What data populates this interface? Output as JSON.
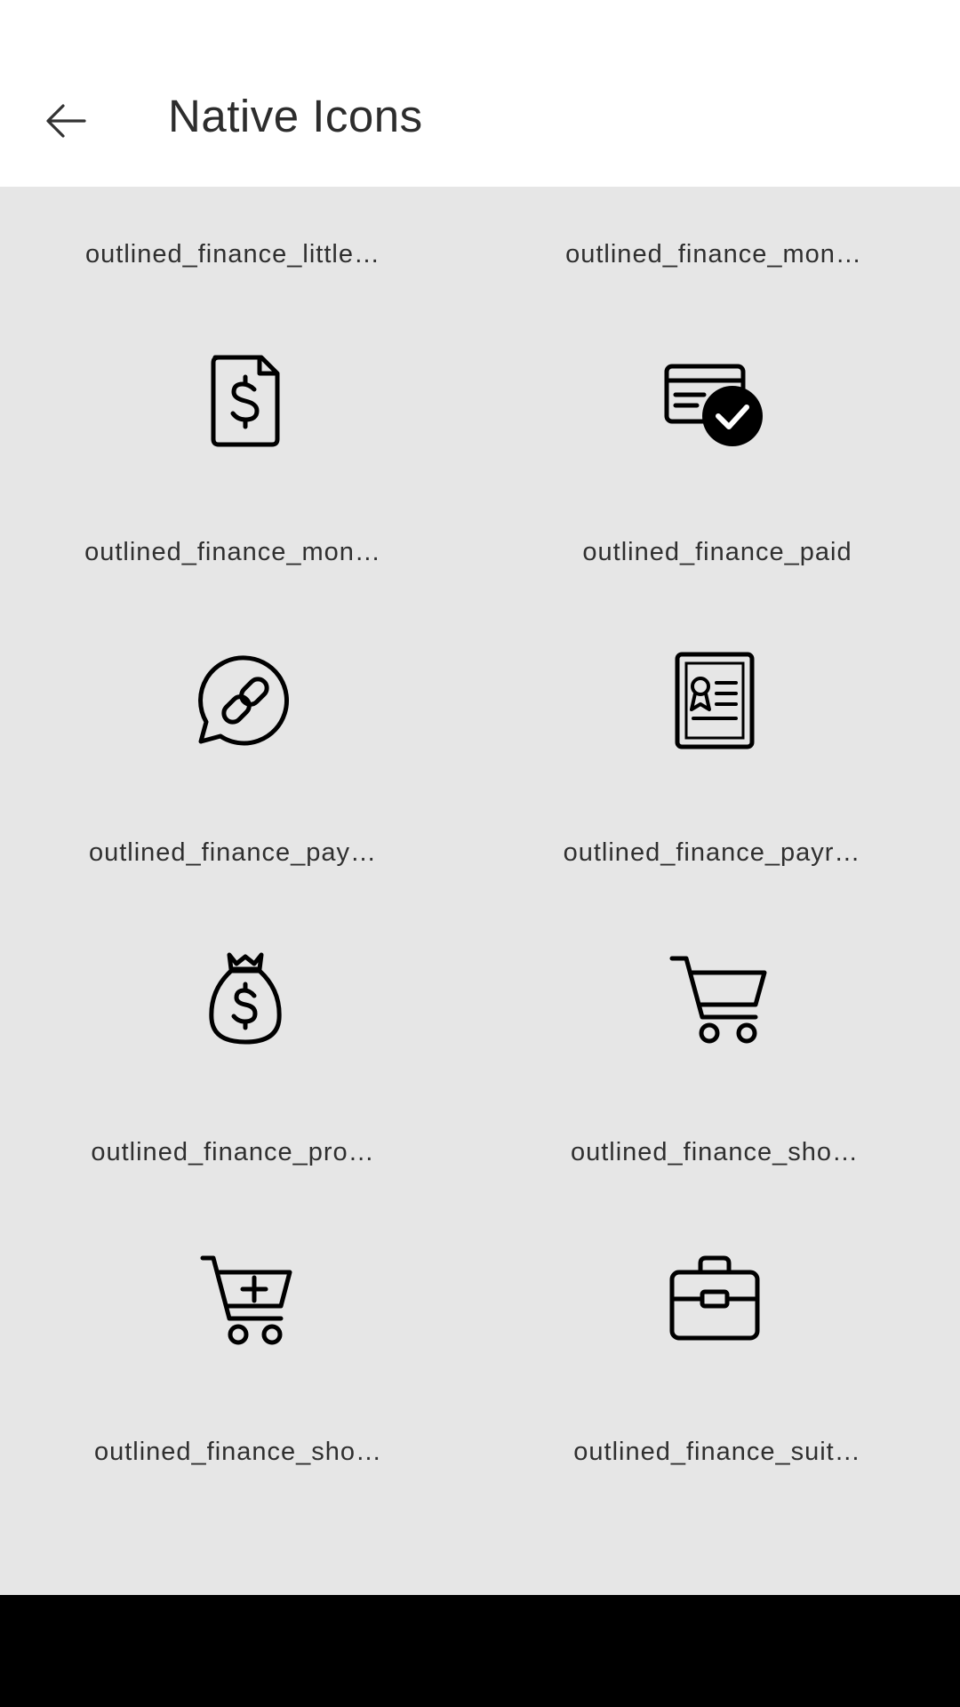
{
  "header": {
    "title": "Native Icons",
    "back_icon": "arrow-left-icon"
  },
  "grid": {
    "items": [
      {
        "label": "outlined_finance_little…",
        "icon": "calculator-icon"
      },
      {
        "label": "outlined_finance_mon…",
        "icon": "money-circle-icon"
      },
      {
        "label": "outlined_finance_mon…",
        "icon": "dollar-document-icon"
      },
      {
        "label": "outlined_finance_paid",
        "icon": "paid-card-check-icon"
      },
      {
        "label": "outlined_finance_pay…",
        "icon": "payment-link-bubble-icon"
      },
      {
        "label": "outlined_finance_payr…",
        "icon": "payroll-certificate-icon"
      },
      {
        "label": "outlined_finance_pro…",
        "icon": "money-bag-icon"
      },
      {
        "label": "outlined_finance_sho…",
        "icon": "shopping-cart-icon"
      },
      {
        "label": "outlined_finance_sho…",
        "icon": "cart-add-icon"
      },
      {
        "label": "outlined_finance_suit…",
        "icon": "suitcase-icon"
      }
    ]
  }
}
